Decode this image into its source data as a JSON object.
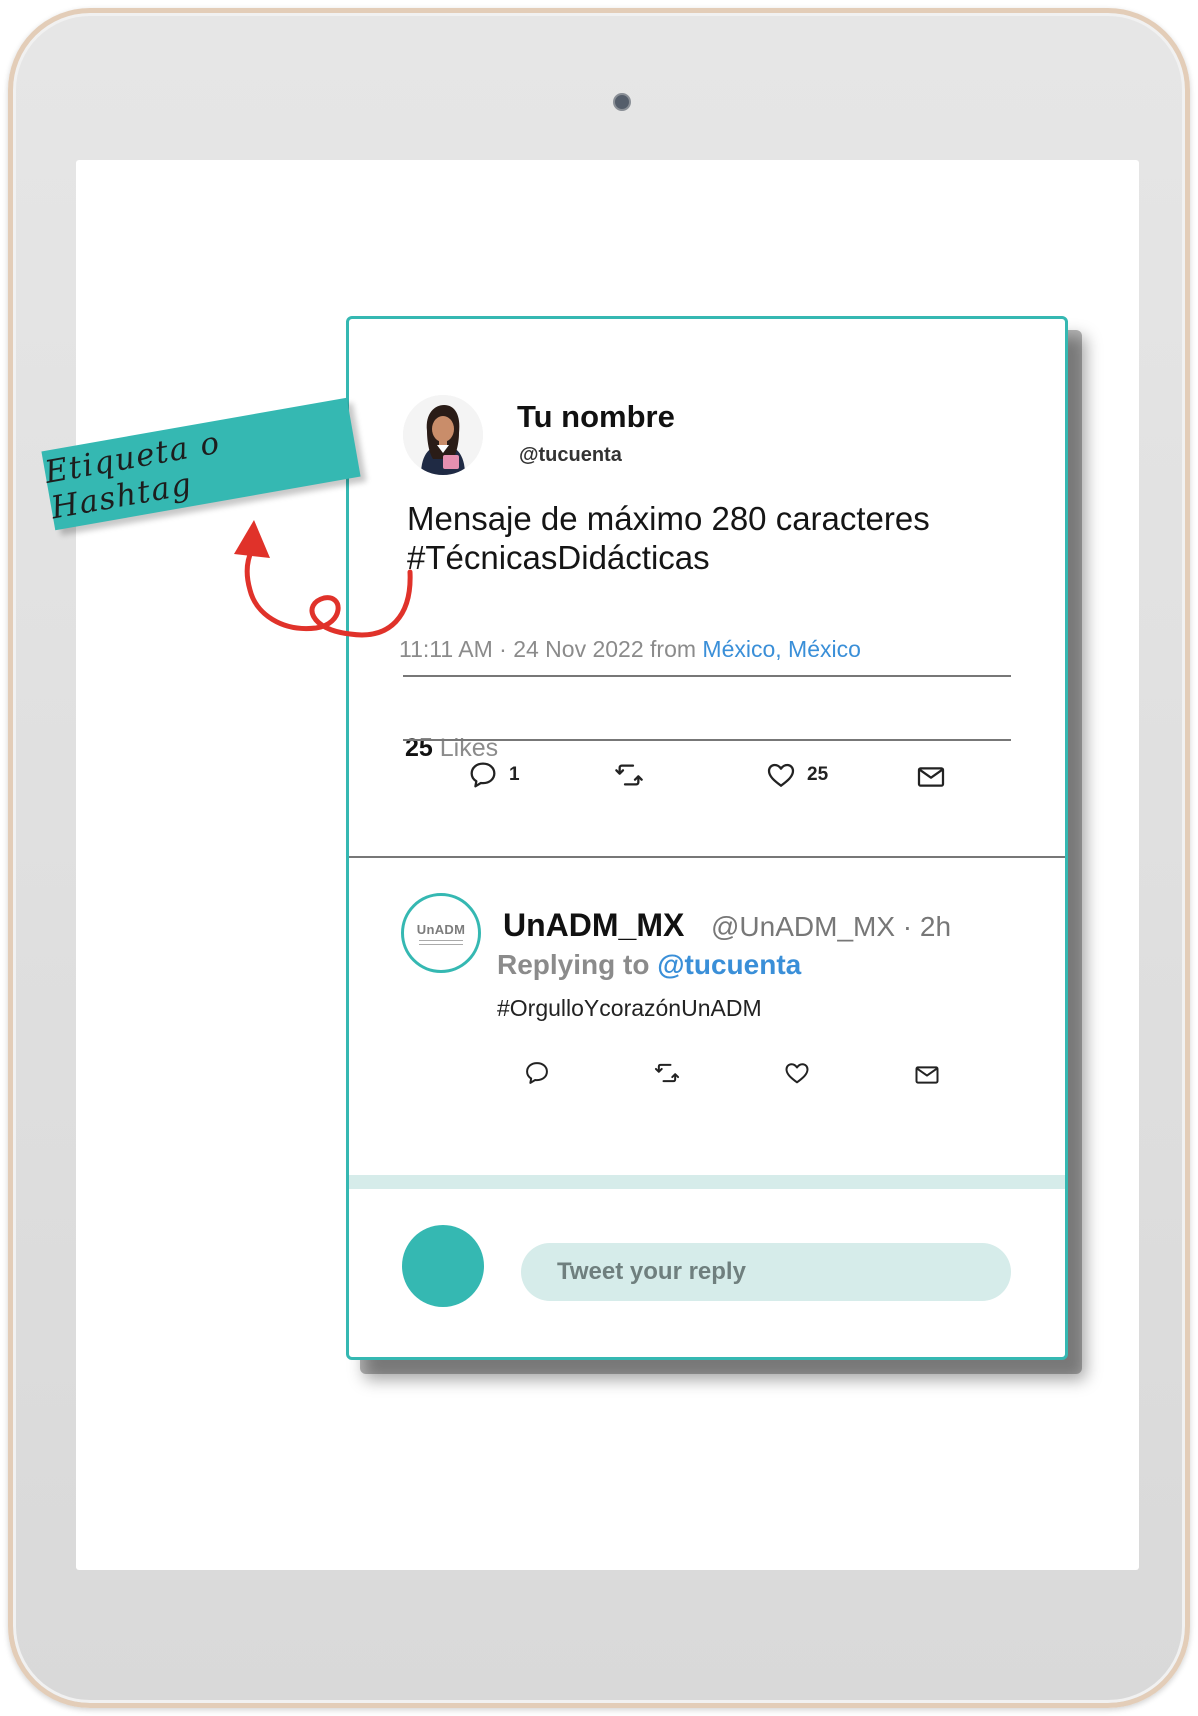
{
  "tweet": {
    "name": "Tu nombre",
    "handle": "@tucuenta",
    "message_line1": "Mensaje de máximo 280 caracteres",
    "message_line2": "#TécnicasDidácticas",
    "meta_time": "11:11 AM · 24 Nov 2022 from ",
    "meta_location": "México, México",
    "likes_count": "25",
    "likes_label": " Likes",
    "actions": {
      "reply_count": "1",
      "like_count": "25"
    }
  },
  "reply": {
    "name": "UnADM_MX",
    "handle": "@UnADM_MX · 2h",
    "replying_prefix": "Replying to ",
    "replying_mention": "@tucuenta",
    "text": "#OrgulloYcorazónUnADM",
    "logo_text": "UnADM"
  },
  "compose": {
    "placeholder": "Tweet your reply"
  },
  "annotation": {
    "label": "Etiqueta o Hashtag"
  },
  "colors": {
    "accent": "#35b8b2",
    "link": "#3a8fd8",
    "arrow": "#e0322a",
    "reply_field": "#d6ecea"
  }
}
